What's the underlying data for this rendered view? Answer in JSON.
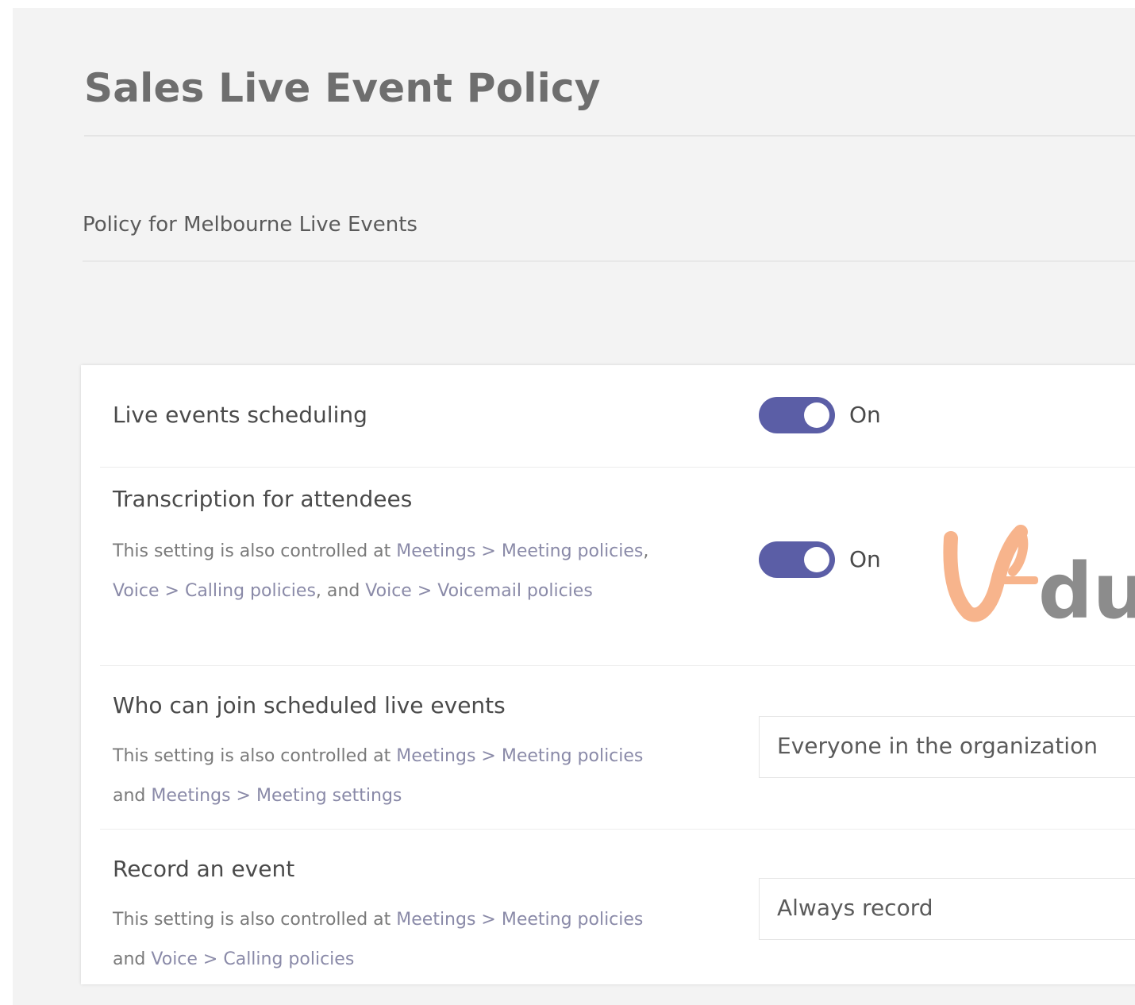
{
  "page": {
    "title": "Sales Live Event Policy",
    "description": "Policy for Melbourne Live Events"
  },
  "settings": [
    {
      "label": "Live events scheduling",
      "control": "toggle",
      "state": "On"
    },
    {
      "label": "Transcription for attendees",
      "help_prefix": "This setting is also controlled at ",
      "help_link_1": "Meetings > Meeting policies",
      "help_sep_1": ", ",
      "help_link_2": "Voice > Calling policies",
      "help_sep_2": ", and ",
      "help_link_3": "Voice > Voicemail policies",
      "control": "toggle",
      "state": "On"
    },
    {
      "label": "Who can join scheduled live events",
      "help_prefix": "This setting is also controlled at ",
      "help_link_1": "Meetings > Meeting policies",
      "help_sep_1": " and ",
      "help_link_2": "Meetings > Meeting settings",
      "control": "select",
      "value": "Everyone in the organization"
    },
    {
      "label": "Record an event",
      "help_prefix": "This setting is also controlled at ",
      "help_link_1": "Meetings > Meeting policies",
      "help_sep_1": " and ",
      "help_link_2": "Voice > Calling policies",
      "control": "select",
      "value": "Always record"
    }
  ],
  "watermark": {
    "text": "du",
    "icon": "v-logo-icon",
    "colors": {
      "logo": "#f7b48c",
      "text": "#8c8c8c"
    }
  },
  "colors": {
    "toggle_on": "#5b5ea6",
    "background": "#f3f3f3",
    "card": "#ffffff"
  }
}
